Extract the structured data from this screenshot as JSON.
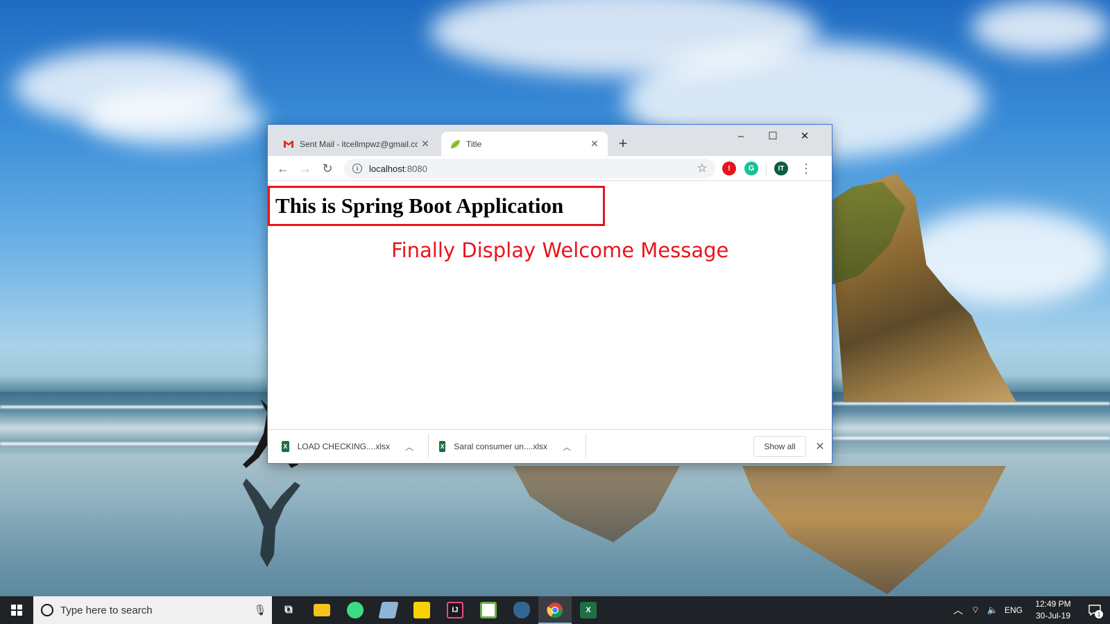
{
  "browser": {
    "tabs": [
      {
        "title": "Sent Mail - itcellmpwz@gmail.co",
        "favicon": "gmail-icon",
        "active": false
      },
      {
        "title": "Title",
        "favicon": "spring-leaf-icon",
        "active": true
      }
    ],
    "new_tab_symbol": "+",
    "window_controls": {
      "minimize": "–",
      "maximize": "☐",
      "close": "✕"
    },
    "address": {
      "host": "localhost",
      "port": ":8080"
    },
    "extensions": [
      {
        "name": "adblock-icon",
        "color": "#e8141c",
        "label": "!"
      },
      {
        "name": "grammarly-icon",
        "color": "#15c39a",
        "label": "G"
      },
      {
        "name": "profile-avatar",
        "color": "#0b5c45",
        "label": "IT"
      }
    ]
  },
  "page": {
    "heading": "This is Spring Boot Application",
    "annotation": "Finally Display Welcome Message",
    "highlight_color": "#e8141c"
  },
  "downloads": {
    "items": [
      {
        "name": "LOAD CHECKING....xlsx"
      },
      {
        "name": "Saral consumer un....xlsx"
      }
    ],
    "show_all_label": "Show all"
  },
  "taskbar": {
    "search_placeholder": "Type here to search",
    "pinned": [
      {
        "name": "task-view-icon",
        "color": "#1f2226",
        "label": ""
      },
      {
        "name": "file-explorer-icon",
        "color": "#f4c21b",
        "label": ""
      },
      {
        "name": "android-studio-icon",
        "color": "#3ddc84",
        "label": ""
      },
      {
        "name": "notepad-icon",
        "color": "#8fb4d8",
        "label": ""
      },
      {
        "name": "sticky-notes-icon",
        "color": "#f7d100",
        "label": ""
      },
      {
        "name": "intellij-icon",
        "color": "#1a1a1a",
        "label": "IJ"
      },
      {
        "name": "notepad-plus-icon",
        "color": "#6ab04c",
        "label": ""
      },
      {
        "name": "postgresql-icon",
        "color": "#336791",
        "label": ""
      },
      {
        "name": "chrome-icon",
        "color": "#ea4335",
        "label": ""
      },
      {
        "name": "excel-icon",
        "color": "#1d7043",
        "label": "X"
      }
    ],
    "tray": {
      "language": "ENG"
    },
    "clock": {
      "time": "12:49 PM",
      "date": "30-Jul-19"
    },
    "notification_count": "1"
  }
}
